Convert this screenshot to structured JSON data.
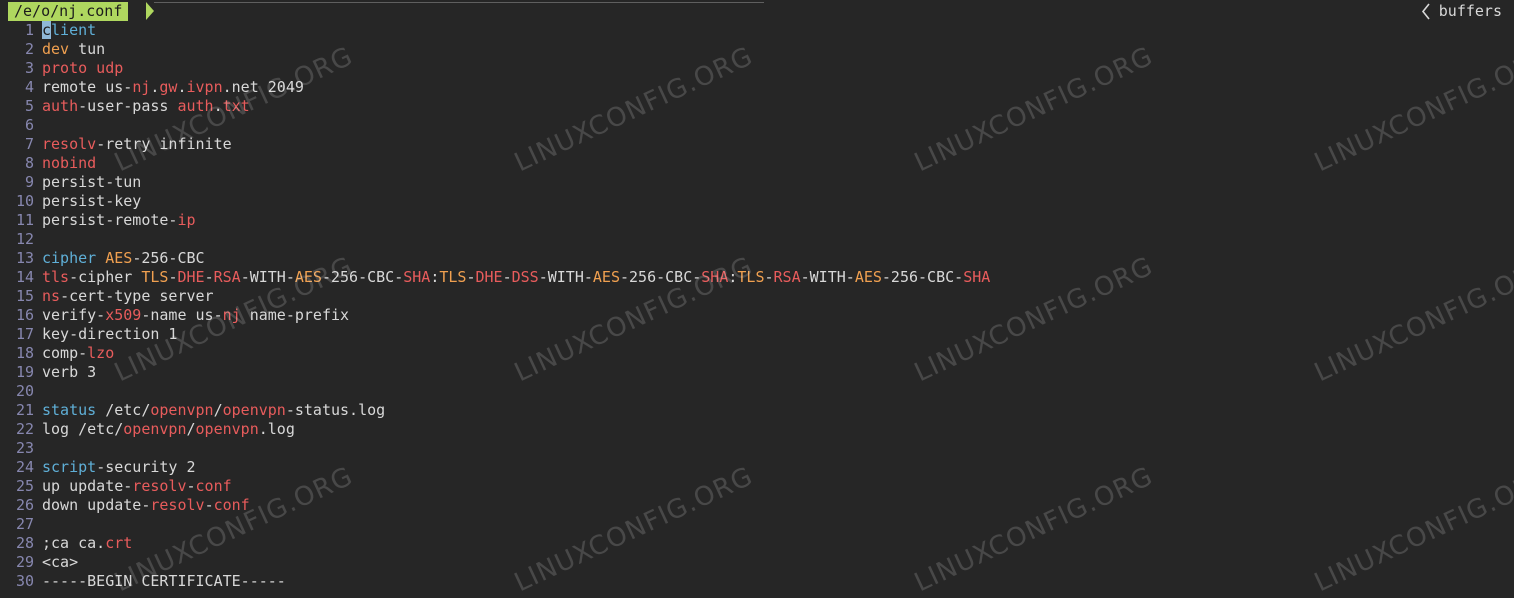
{
  "tabline": {
    "active_tab": "/e/o/nj.conf",
    "buffers_label": "buffers",
    "buffers_icon": "chevron-left-icon",
    "accent_color": "#afd75f"
  },
  "colors": {
    "keyword": "#5fafd7",
    "red": "#e85c5c",
    "orange": "#f0a050",
    "text": "#d8d8d8",
    "line_number": "#8787af",
    "background": "#262626"
  },
  "lines": [
    {
      "n": "1",
      "tokens": [
        {
          "t": "c",
          "c": "cursor"
        },
        {
          "t": "lient",
          "c": "kw"
        }
      ]
    },
    {
      "n": "2",
      "tokens": [
        {
          "t": "dev",
          "c": "or"
        },
        {
          "t": " tun",
          "c": "code"
        }
      ]
    },
    {
      "n": "3",
      "tokens": [
        {
          "t": "proto udp",
          "c": "rd"
        }
      ]
    },
    {
      "n": "4",
      "tokens": [
        {
          "t": "remote us-",
          "c": "code"
        },
        {
          "t": "nj",
          "c": "rd"
        },
        {
          "t": ".",
          "c": "code"
        },
        {
          "t": "gw",
          "c": "rd"
        },
        {
          "t": ".",
          "c": "code"
        },
        {
          "t": "ivpn",
          "c": "rd"
        },
        {
          "t": ".net 2049",
          "c": "code"
        }
      ]
    },
    {
      "n": "5",
      "tokens": [
        {
          "t": "auth",
          "c": "rd"
        },
        {
          "t": "-user-pass ",
          "c": "code"
        },
        {
          "t": "auth",
          "c": "rd"
        },
        {
          "t": ".",
          "c": "code"
        },
        {
          "t": "txt",
          "c": "rd"
        }
      ]
    },
    {
      "n": "6",
      "tokens": []
    },
    {
      "n": "7",
      "tokens": [
        {
          "t": "resolv",
          "c": "rd"
        },
        {
          "t": "-retry infinite",
          "c": "code"
        }
      ]
    },
    {
      "n": "8",
      "tokens": [
        {
          "t": "nobind",
          "c": "rd"
        }
      ]
    },
    {
      "n": "9",
      "tokens": [
        {
          "t": "persist-tun",
          "c": "code"
        }
      ]
    },
    {
      "n": "10",
      "tokens": [
        {
          "t": "persist-key",
          "c": "code"
        }
      ]
    },
    {
      "n": "11",
      "tokens": [
        {
          "t": "persist-remote-",
          "c": "code"
        },
        {
          "t": "ip",
          "c": "rd"
        }
      ]
    },
    {
      "n": "12",
      "tokens": []
    },
    {
      "n": "13",
      "tokens": [
        {
          "t": "cipher",
          "c": "kw"
        },
        {
          "t": " ",
          "c": "code"
        },
        {
          "t": "AES",
          "c": "or"
        },
        {
          "t": "-256-CBC",
          "c": "code"
        }
      ]
    },
    {
      "n": "14",
      "tokens": [
        {
          "t": "tls",
          "c": "rd"
        },
        {
          "t": "-cipher ",
          "c": "code"
        },
        {
          "t": "TLS",
          "c": "or"
        },
        {
          "t": "-",
          "c": "code"
        },
        {
          "t": "DHE",
          "c": "rd"
        },
        {
          "t": "-",
          "c": "code"
        },
        {
          "t": "RSA",
          "c": "rd"
        },
        {
          "t": "-WITH-",
          "c": "code"
        },
        {
          "t": "AES",
          "c": "or"
        },
        {
          "t": "-256-CBC-",
          "c": "code"
        },
        {
          "t": "SHA",
          "c": "rd"
        },
        {
          "t": ":",
          "c": "code"
        },
        {
          "t": "TLS",
          "c": "or"
        },
        {
          "t": "-",
          "c": "code"
        },
        {
          "t": "DHE",
          "c": "rd"
        },
        {
          "t": "-",
          "c": "code"
        },
        {
          "t": "DSS",
          "c": "rd"
        },
        {
          "t": "-WITH-",
          "c": "code"
        },
        {
          "t": "AES",
          "c": "or"
        },
        {
          "t": "-256-CBC-",
          "c": "code"
        },
        {
          "t": "SHA",
          "c": "rd"
        },
        {
          "t": ":",
          "c": "code"
        },
        {
          "t": "TLS",
          "c": "or"
        },
        {
          "t": "-",
          "c": "code"
        },
        {
          "t": "RSA",
          "c": "rd"
        },
        {
          "t": "-WITH-",
          "c": "code"
        },
        {
          "t": "AES",
          "c": "or"
        },
        {
          "t": "-256-CBC-",
          "c": "code"
        },
        {
          "t": "SHA",
          "c": "rd"
        }
      ]
    },
    {
      "n": "15",
      "tokens": [
        {
          "t": "ns",
          "c": "rd"
        },
        {
          "t": "-cert-type server",
          "c": "code"
        }
      ]
    },
    {
      "n": "16",
      "tokens": [
        {
          "t": "verify-",
          "c": "code"
        },
        {
          "t": "x509",
          "c": "rd"
        },
        {
          "t": "-name us-",
          "c": "code"
        },
        {
          "t": "nj",
          "c": "rd"
        },
        {
          "t": " name-prefix",
          "c": "code"
        }
      ]
    },
    {
      "n": "17",
      "tokens": [
        {
          "t": "key-direction 1",
          "c": "code"
        }
      ]
    },
    {
      "n": "18",
      "tokens": [
        {
          "t": "comp-",
          "c": "code"
        },
        {
          "t": "lzo",
          "c": "rd"
        }
      ]
    },
    {
      "n": "19",
      "tokens": [
        {
          "t": "verb 3",
          "c": "code"
        }
      ]
    },
    {
      "n": "20",
      "tokens": []
    },
    {
      "n": "21",
      "tokens": [
        {
          "t": "status",
          "c": "kw"
        },
        {
          "t": " /etc/",
          "c": "code"
        },
        {
          "t": "openvpn",
          "c": "rd"
        },
        {
          "t": "/",
          "c": "code"
        },
        {
          "t": "openvpn",
          "c": "rd"
        },
        {
          "t": "-status.log",
          "c": "code"
        }
      ]
    },
    {
      "n": "22",
      "tokens": [
        {
          "t": "log /etc/",
          "c": "code"
        },
        {
          "t": "openvpn",
          "c": "rd"
        },
        {
          "t": "/",
          "c": "code"
        },
        {
          "t": "openvpn",
          "c": "rd"
        },
        {
          "t": ".log",
          "c": "code"
        }
      ]
    },
    {
      "n": "23",
      "tokens": []
    },
    {
      "n": "24",
      "tokens": [
        {
          "t": "script",
          "c": "kw"
        },
        {
          "t": "-security 2",
          "c": "code"
        }
      ]
    },
    {
      "n": "25",
      "tokens": [
        {
          "t": "up update-",
          "c": "code"
        },
        {
          "t": "resolv",
          "c": "rd"
        },
        {
          "t": "-",
          "c": "code"
        },
        {
          "t": "conf",
          "c": "rd"
        }
      ]
    },
    {
      "n": "26",
      "tokens": [
        {
          "t": "down update-",
          "c": "code"
        },
        {
          "t": "resolv",
          "c": "rd"
        },
        {
          "t": "-",
          "c": "code"
        },
        {
          "t": "conf",
          "c": "rd"
        }
      ]
    },
    {
      "n": "27",
      "tokens": []
    },
    {
      "n": "28",
      "tokens": [
        {
          "t": ";ca ca.",
          "c": "code"
        },
        {
          "t": "crt",
          "c": "rd"
        }
      ]
    },
    {
      "n": "29",
      "tokens": [
        {
          "t": "<ca>",
          "c": "code"
        }
      ]
    },
    {
      "n": "30",
      "tokens": [
        {
          "t": "-----BEGIN CERTIFICATE-----",
          "c": "code"
        }
      ]
    }
  ],
  "watermark": "LINUXCONFIG.ORG"
}
